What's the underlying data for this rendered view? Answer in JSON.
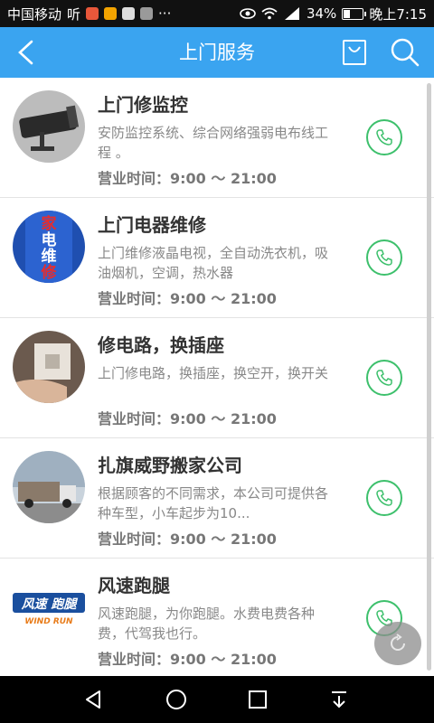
{
  "status_bar": {
    "carrier": "中国移动",
    "extra_glyph": "听",
    "dots": "···",
    "battery_percent": "34%",
    "battery_level": 0.34,
    "time": "晚上7:15"
  },
  "app_bar": {
    "title": "上门服务",
    "icons": [
      "chevron-left-icon",
      "shopping-bag-icon",
      "search-icon"
    ]
  },
  "services": [
    {
      "name": "上门修监控",
      "desc": "安防监控系统、综合网络强弱电布线工程 。",
      "hours_label": "营业时间：9:00 ～ 21:00",
      "thumb": "camera-image"
    },
    {
      "name": "上门电器维修",
      "desc": "上门维修液晶电视，全自动洗衣机，吸油烟机，空调，热水器",
      "hours_label": "营业时间：9:00 ～ 21:00",
      "thumb": "appliance-sign-image",
      "thumb_text": [
        "家",
        "电",
        "维",
        "修"
      ]
    },
    {
      "name": "修电路，换插座",
      "desc": "上门修电路，换插座，换空开，换开关",
      "hours_label": "营业时间：9:00 ～ 21:00",
      "thumb": "socket-image"
    },
    {
      "name": "扎旗威野搬家公司",
      "desc": "根据顾客的不同需求，本公司可提供各种车型，小车起步为10...",
      "hours_label": "营业时间：9:00 ～ 21:00",
      "thumb": "truck-image"
    },
    {
      "name": "风速跑腿",
      "desc": "风速跑腿，为你跑腿。水费电费各种费，代驾我也行。",
      "hours_label": "营业时间：9:00 ～ 21:00",
      "thumb": "windrun-logo",
      "thumb_text": [
        "风速 跑腿",
        "WIND RUN"
      ]
    }
  ],
  "colors": {
    "app_bar": "#3aa4f0",
    "phone_accent": "#3dc06c",
    "title_text": "#333333",
    "secondary_text": "#888888"
  }
}
